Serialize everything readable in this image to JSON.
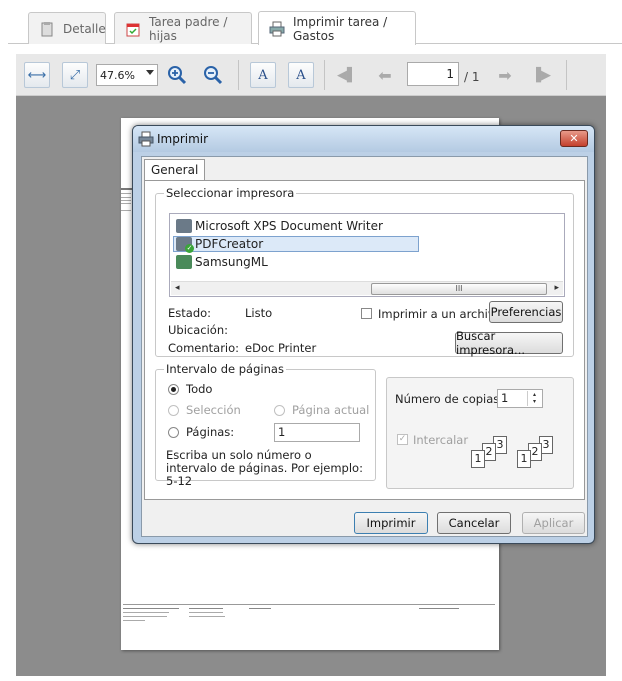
{
  "tabs": [
    {
      "label": "Detalle",
      "icon": "clipboard-icon"
    },
    {
      "label": "Tarea padre / hijas",
      "icon": "calendar-icon"
    },
    {
      "label": "Imprimir tarea / Gastos",
      "icon": "printer-icon"
    }
  ],
  "toolbar": {
    "zoom_value": "47.6%",
    "current_page": "1",
    "total_pages": "/ 1"
  },
  "dialog": {
    "title": "Imprimir",
    "close_label": "✕",
    "tab_general": "General",
    "select_printer_legend": "Seleccionar impresora",
    "printers": [
      "Microsoft XPS Document Writer",
      "PDFCreator",
      "SamsungML"
    ],
    "scroll_thumb_label": "III",
    "estado_label": "Estado:",
    "estado_value": "Listo",
    "ubicacion_label": "Ubicación:",
    "comentario_label": "Comentario:",
    "comentario_value": "eDoc Printer",
    "print_to_file_label": "Imprimir a un archivo",
    "preferences_label": "Preferencias",
    "find_printer_label": "Buscar impresora...",
    "range_legend": "Intervalo de páginas",
    "range_all": "Todo",
    "range_selection": "Selección",
    "range_current": "Página actual",
    "range_pages": "Páginas:",
    "range_pages_value": "1",
    "range_hint": "Escriba un solo número o intervalo de páginas. Por ejemplo: 5-12",
    "copies_label": "Número de copias:",
    "copies_value": "1",
    "collate_label": "Intercalar",
    "print_button": "Imprimir",
    "cancel_button": "Cancelar",
    "apply_button": "Aplicar"
  }
}
